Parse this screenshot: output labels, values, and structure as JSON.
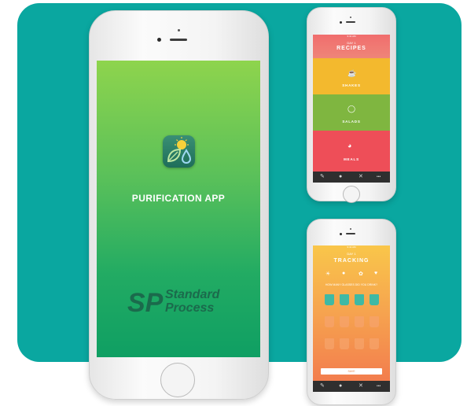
{
  "main_screen": {
    "app_title": "PURIFICATION APP",
    "app_icon": "sun-leaf-droplet-icon",
    "brand_line1": "Standard",
    "brand_line2": "Process"
  },
  "recipes_screen": {
    "status": "9:41 AM",
    "header_small": "DAY 1",
    "title": "RECIPES",
    "categories": [
      {
        "label": "SHAKES",
        "icon": "cup-icon",
        "color": "#f3b92e"
      },
      {
        "label": "SALADS",
        "icon": "bowl-icon",
        "color": "#7fb640"
      },
      {
        "label": "MEALS",
        "icon": "plate-icon",
        "color": "#ee4e58"
      }
    ],
    "tabs": [
      "pencil-icon",
      "drop-icon",
      "fork-icon",
      "more-icon"
    ]
  },
  "tracker_screen": {
    "status": "9:41 AM",
    "header_small": "DAY 1",
    "title": "TRACKING",
    "subtitle": "HOW MANY GLASSES DID YOU DRINK?",
    "glasses_filled": 4,
    "glasses_total": 12,
    "log_button": "SAVE",
    "tabs": [
      "pencil-icon",
      "drop-icon",
      "fork-icon",
      "more-icon"
    ]
  },
  "colors": {
    "teal_panel": "#0aa7a0",
    "main_gradient_top": "#8ed44d",
    "main_gradient_bottom": "#0f9f63",
    "filled_glass": "#3fb9a4",
    "empty_glass": "#f6a36b"
  }
}
